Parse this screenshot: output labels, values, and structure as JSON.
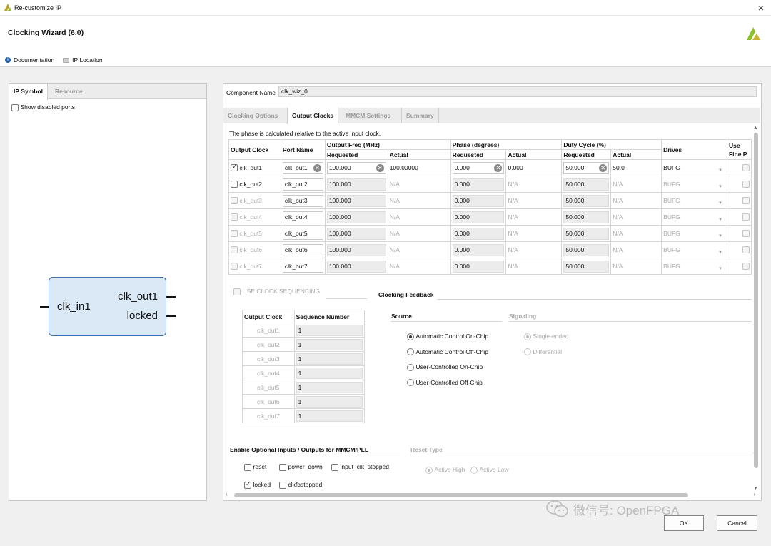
{
  "window": {
    "title": "Re-customize IP",
    "close": "×"
  },
  "header": {
    "title": "Clocking Wizard (6.0)",
    "documentation": "Documentation",
    "ip_location": "IP Location"
  },
  "left_panel": {
    "tabs": [
      "IP Symbol",
      "Resource"
    ],
    "show_disabled_ports": "Show disabled ports",
    "symbol": {
      "input": "clk_in1",
      "outputs": [
        "clk_out1",
        "locked"
      ]
    }
  },
  "component": {
    "label": "Component Name",
    "value": "clk_wiz_0"
  },
  "config_tabs": [
    "Clocking Options",
    "Output Clocks",
    "MMCM Settings",
    "Summary"
  ],
  "phase_note": "The phase is calculated relative to the active input clock.",
  "clock_table": {
    "headers": {
      "output_clock": "Output Clock",
      "port_name": "Port Name",
      "output_freq": "Output Freq (MHz)",
      "phase": "Phase (degrees)",
      "duty": "Duty Cycle (%)",
      "drives": "Drives",
      "use_fine": "Use Fine P",
      "requested": "Requested",
      "actual": "Actual"
    },
    "rows": [
      {
        "name": "clk_out1",
        "port": "clk_out1",
        "freq_req": "100.000",
        "freq_act": "100.00000",
        "phase_req": "0.000",
        "phase_act": "0.000",
        "duty_req": "50.000",
        "duty_act": "50.0",
        "drives": "BUFG",
        "checked": true
      },
      {
        "name": "clk_out2",
        "port": "clk_out2",
        "freq_req": "100.000",
        "freq_act": "N/A",
        "phase_req": "0.000",
        "phase_act": "N/A",
        "duty_req": "50.000",
        "duty_act": "N/A",
        "drives": "BUFG",
        "checked": false
      },
      {
        "name": "clk_out3",
        "port": "clk_out3",
        "freq_req": "100.000",
        "freq_act": "N/A",
        "phase_req": "0.000",
        "phase_act": "N/A",
        "duty_req": "50.000",
        "duty_act": "N/A",
        "drives": "BUFG",
        "checked": false
      },
      {
        "name": "clk_out4",
        "port": "clk_out4",
        "freq_req": "100.000",
        "freq_act": "N/A",
        "phase_req": "0.000",
        "phase_act": "N/A",
        "duty_req": "50.000",
        "duty_act": "N/A",
        "drives": "BUFG",
        "checked": false
      },
      {
        "name": "clk_out5",
        "port": "clk_out5",
        "freq_req": "100.000",
        "freq_act": "N/A",
        "phase_req": "0.000",
        "phase_act": "N/A",
        "duty_req": "50.000",
        "duty_act": "N/A",
        "drives": "BUFG",
        "checked": false
      },
      {
        "name": "clk_out6",
        "port": "clk_out6",
        "freq_req": "100.000",
        "freq_act": "N/A",
        "phase_req": "0.000",
        "phase_act": "N/A",
        "duty_req": "50.000",
        "duty_act": "N/A",
        "drives": "BUFG",
        "checked": false
      },
      {
        "name": "clk_out7",
        "port": "clk_out7",
        "freq_req": "100.000",
        "freq_act": "N/A",
        "phase_req": "0.000",
        "phase_act": "N/A",
        "duty_req": "50.000",
        "duty_act": "N/A",
        "drives": "BUFG",
        "checked": false
      }
    ]
  },
  "sequencing": {
    "label": "USE CLOCK SEQUENCING",
    "headers": [
      "Output Clock",
      "Sequence Number"
    ],
    "rows": [
      {
        "clock": "clk_out1",
        "seq": "1"
      },
      {
        "clock": "clk_out2",
        "seq": "1"
      },
      {
        "clock": "clk_out3",
        "seq": "1"
      },
      {
        "clock": "clk_out4",
        "seq": "1"
      },
      {
        "clock": "clk_out5",
        "seq": "1"
      },
      {
        "clock": "clk_out6",
        "seq": "1"
      },
      {
        "clock": "clk_out7",
        "seq": "1"
      }
    ]
  },
  "feedback": {
    "title": "Clocking Feedback",
    "source_label": "Source",
    "signaling_label": "Signaling",
    "sources": [
      "Automatic Control On-Chip",
      "Automatic Control Off-Chip",
      "User-Controlled On-Chip",
      "User-Controlled Off-Chip"
    ],
    "signaling": [
      "Single-ended",
      "Differential"
    ]
  },
  "optional_io": {
    "title": "Enable Optional Inputs / Outputs for MMCM/PLL",
    "items": [
      {
        "label": "reset",
        "checked": false
      },
      {
        "label": "power_down",
        "checked": false
      },
      {
        "label": "input_clk_stopped",
        "checked": false
      },
      {
        "label": "locked",
        "checked": true
      },
      {
        "label": "clkfbstopped",
        "checked": false
      }
    ]
  },
  "reset_type": {
    "title": "Reset Type",
    "options": [
      "Active High",
      "Active Low"
    ]
  },
  "buttons": {
    "ok": "OK",
    "cancel": "Cancel"
  },
  "watermark": "微信号: OpenFPGA",
  "colors": {
    "accent": "#3a6fb0",
    "symbol_fill": "#dbe9f7",
    "brand_green": "#8bbf2a"
  }
}
